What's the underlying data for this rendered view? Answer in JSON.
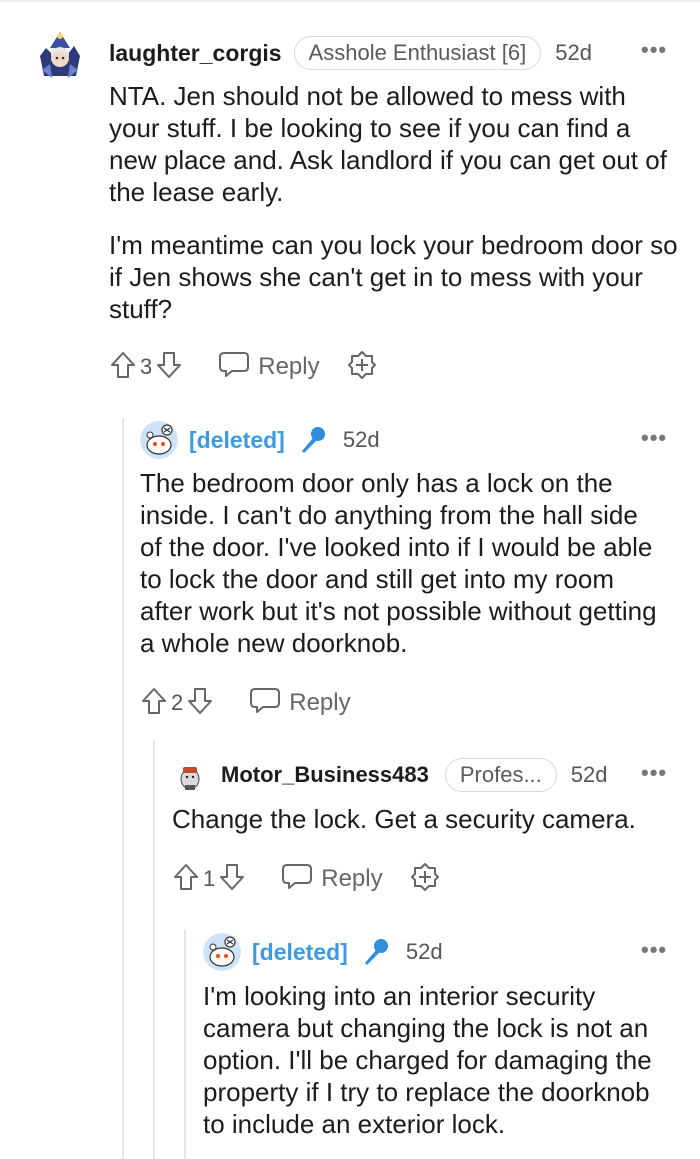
{
  "comments": [
    {
      "username": "laughter_corgis",
      "flair": "Asshole Enthusiast [6]",
      "time": "52d",
      "paragraphs": [
        "NTA. Jen should not be allowed to mess with your stuff. I be looking to see if you can find a new place and. Ask landlord if you can get out of the lease early.",
        "I'm meantime can you lock your bedroom door so if Jen shows she can't get in to mess with your stuff?"
      ],
      "votes": "3",
      "reply_label": "Reply",
      "more_label": "•••"
    },
    {
      "username": "[deleted]",
      "time": "52d",
      "paragraphs": [
        "The bedroom door only has a lock on the inside. I can't do anything from the hall side of the door. I've looked into if I would be able to lock the door and still get into my room after work but it's not possible without getting a whole new doorknob."
      ],
      "votes": "2",
      "reply_label": "Reply",
      "more_label": "•••"
    },
    {
      "username": "Motor_Business483",
      "flair": "Profes...",
      "time": "52d",
      "paragraphs": [
        "Change the lock. Get a security camera."
      ],
      "votes": "1",
      "reply_label": "Reply",
      "more_label": "•••"
    },
    {
      "username": "[deleted]",
      "time": "52d",
      "paragraphs": [
        "I'm looking into an interior security camera but changing the lock is not an option. I'll be charged for damaging the property if I try to replace the doorknob to include an exterior lock."
      ],
      "more_label": "•••"
    }
  ],
  "colors": {
    "deleted_username": "#3d9ae0",
    "thread_line": "#e5e5e5",
    "mic_icon": "#2f8fdc"
  },
  "icons": [
    "upvote-icon",
    "downvote-icon",
    "reply-icon",
    "award-icon",
    "microphone-icon",
    "more-icon"
  ]
}
